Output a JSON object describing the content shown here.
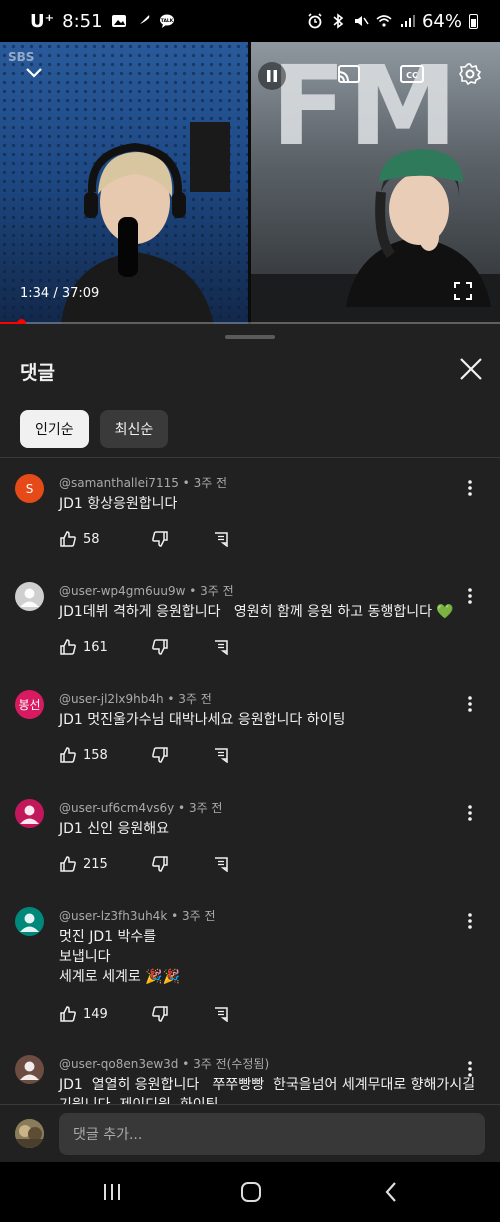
{
  "status_bar": {
    "carrier": "U⁺",
    "time": "8:51",
    "battery": "64%"
  },
  "video": {
    "time": "1:34 / 37:09",
    "progress_fraction": 0.042,
    "left_watermark": "SBS",
    "right_watermark": "FM"
  },
  "sheet": {
    "title": "댓글",
    "chips": [
      {
        "label": "인기순",
        "active": true
      },
      {
        "label": "최신순",
        "active": false
      }
    ]
  },
  "comments": [
    {
      "user": "@samanthallei7115",
      "time": "3주 전",
      "lines": [
        "JD1 항상응원합니다"
      ],
      "likes": "58",
      "avatar_text": "S",
      "avatar_color": "#e64a19"
    },
    {
      "user": "@user-wp4gm6uu9w",
      "time": "3주 전",
      "lines": [
        "JD1데뷔 격하게 응원합니다   영원히 함께 응원 하고 동행합니다 💚"
      ],
      "likes": "161",
      "avatar_text": "",
      "avatar_color": "#cfcfcf"
    },
    {
      "user": "@user-jl2lx9hb4h",
      "time": "3주 전",
      "lines": [
        "JD1 멋진울가수님 대박나세요 응원합니다 하이팅"
      ],
      "likes": "158",
      "avatar_text": "봉선",
      "avatar_color": "#d81b60"
    },
    {
      "user": "@user-uf6cm4vs6y",
      "time": "3주 전",
      "lines": [
        "JD1 신인 응원해요"
      ],
      "likes": "215",
      "avatar_text": "",
      "avatar_color": "#c2185b"
    },
    {
      "user": "@user-lz3fh3uh4k",
      "time": "3주 전",
      "lines": [
        "멋진 JD1 박수를",
        "보냅니다",
        "세계로 세계로 🎉🎉"
      ],
      "likes": "149",
      "avatar_text": "",
      "avatar_color": "#00897b"
    },
    {
      "user": "@user-qo8en3ew3d",
      "time": "3주 전(수정됨)",
      "lines": [
        "JD1  열열히 응원합니다   쭈쭈빵빵  한국을넘어 세계무대로 향해가시길",
        "기원니다  제이디원  화이팅"
      ],
      "likes": "",
      "avatar_text": "",
      "avatar_color": "#6d4c41"
    }
  ],
  "add_comment": {
    "placeholder": "댓글 추가..."
  },
  "colors": {
    "background": "#0f0f0f",
    "sheet": "#212121",
    "progress": "#ff0000"
  }
}
